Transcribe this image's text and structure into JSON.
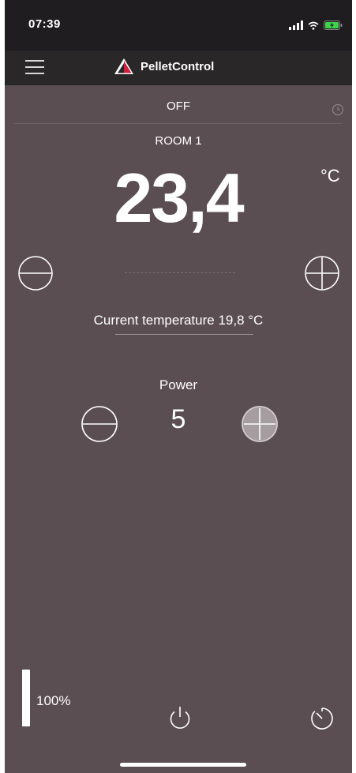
{
  "status_bar": {
    "time": "07:39"
  },
  "app_bar": {
    "title": "PelletControl",
    "menu_icon": "hamburger-icon",
    "logo": "triangle-logo"
  },
  "mode": {
    "label": "OFF",
    "schedule_icon": "clock-icon"
  },
  "room": {
    "name": "ROOM 1",
    "setpoint": "23,4",
    "unit": "°C"
  },
  "current_temp": {
    "label": "Current temperature 19,8 °C"
  },
  "power": {
    "label": "Power",
    "value": "5"
  },
  "level": {
    "text": "100%",
    "fraction": 1.0
  },
  "colors": {
    "background": "#5b4e53",
    "header": "#2a2729",
    "accent_red": "#d0203c",
    "text": "#ffffff"
  },
  "icons": {
    "decrease": "minus-circle-icon",
    "increase": "plus-circle-icon",
    "power_off": "power-icon",
    "timer": "timer-icon"
  }
}
